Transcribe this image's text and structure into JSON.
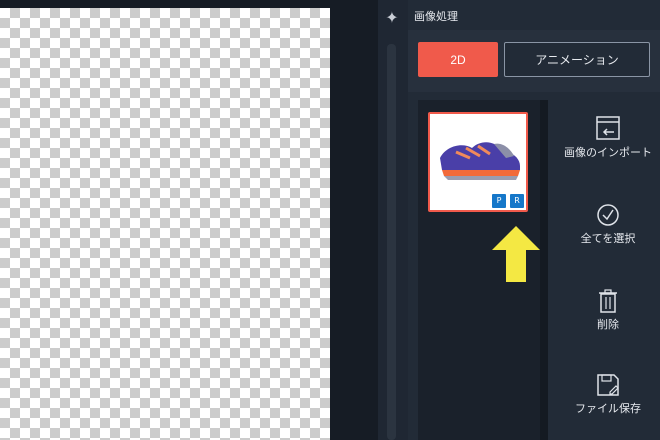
{
  "panel": {
    "title": "画像処理",
    "mode_2d_label": "2D",
    "mode_animation_label": "アニメーション"
  },
  "thumbnail": {
    "badge_p": "P",
    "badge_r": "R"
  },
  "tools": {
    "import_label": "画像のインポート",
    "select_all_label": "全てを選択",
    "delete_label": "削除",
    "save_label": "ファイル保存"
  },
  "colors": {
    "accent": "#f05a4b",
    "panel_bg": "#222b37",
    "badge_blue": "#1577c9",
    "arrow_yellow": "#f4e843"
  },
  "icons": [
    "compass-icon",
    "import-icon",
    "check-circle-icon",
    "trash-icon",
    "save-file-icon",
    "down-arrow-icon"
  ]
}
